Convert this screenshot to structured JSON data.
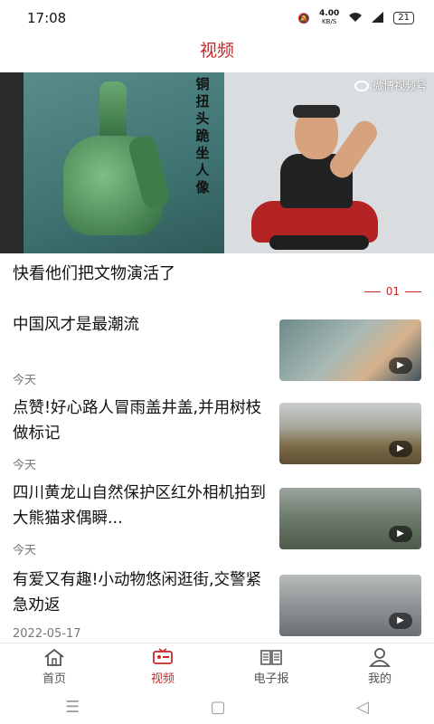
{
  "status_bar": {
    "time": "17:08",
    "net_speed": "4.00",
    "net_unit": "KB/S",
    "battery": "21"
  },
  "header": {
    "title": "视频"
  },
  "hero": {
    "vertical_caption": "铜扭头跪坐人像",
    "watermark": "微博视频号",
    "title": "快看他们把文物演活了",
    "page_indicator": "01"
  },
  "news": [
    {
      "title": "中国风才是最潮流",
      "meta": "今天"
    },
    {
      "title": "点赞!好心路人冒雨盖井盖,并用树枝做标记",
      "meta": "今天"
    },
    {
      "title": "四川黄龙山自然保护区红外相机拍到大熊猫求偶瞬...",
      "meta": "今天"
    },
    {
      "title": "有爱又有趣!小动物悠闲逛街,交警紧急劝返",
      "meta": "2022-05-17"
    }
  ],
  "tabbar": [
    {
      "label": "首页",
      "icon": "home-icon",
      "active": false
    },
    {
      "label": "视频",
      "icon": "video-icon",
      "active": true
    },
    {
      "label": "电子报",
      "icon": "newspaper-icon",
      "active": false
    },
    {
      "label": "我的",
      "icon": "profile-icon",
      "active": false
    }
  ],
  "colors": {
    "accent": "#c62828",
    "text": "#111111",
    "meta": "#777777"
  }
}
